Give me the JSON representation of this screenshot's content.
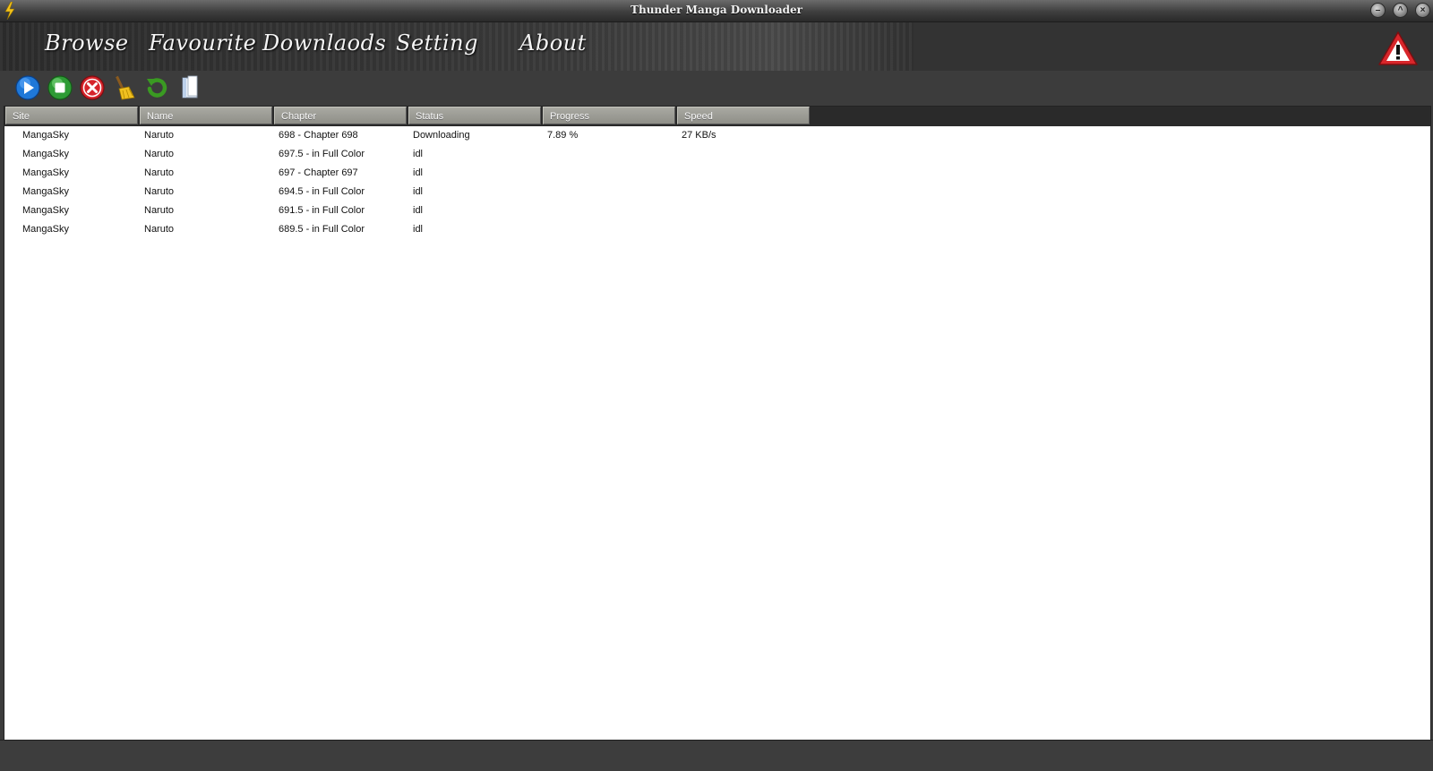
{
  "window": {
    "title": "Thunder Manga Downloader"
  },
  "menu": {
    "items": [
      "Browse",
      "Favourite",
      "Downlaods",
      "Setting",
      "About"
    ]
  },
  "toolbar": {
    "buttons": [
      "play-icon",
      "stop-icon",
      "cancel-icon",
      "broom-icon",
      "refresh-icon",
      "document-icon"
    ]
  },
  "table": {
    "columns": [
      "Site",
      "Name",
      "Chapter",
      "Status",
      "Progress",
      "Speed"
    ],
    "rows": [
      [
        "MangaSky",
        "Naruto",
        "698 - Chapter 698",
        "Downloading",
        "7.89 %",
        "27 KB/s"
      ],
      [
        "MangaSky",
        "Naruto",
        "697.5 - in Full Color",
        "idl",
        "",
        ""
      ],
      [
        "MangaSky",
        "Naruto",
        "697 - Chapter 697",
        "idl",
        "",
        ""
      ],
      [
        "MangaSky",
        "Naruto",
        "694.5 - in Full Color",
        "idl",
        "",
        ""
      ],
      [
        "MangaSky",
        "Naruto",
        "691.5 - in Full Color",
        "idl",
        "",
        ""
      ],
      [
        "MangaSky",
        "Naruto",
        "689.5 - in Full Color",
        "idl",
        "",
        ""
      ]
    ]
  },
  "colors": {
    "header_bg": "#9c9c95",
    "chrome_bg": "#3c3c3c",
    "list_bg": "#ffffff",
    "warning_red": "#d8262b"
  }
}
